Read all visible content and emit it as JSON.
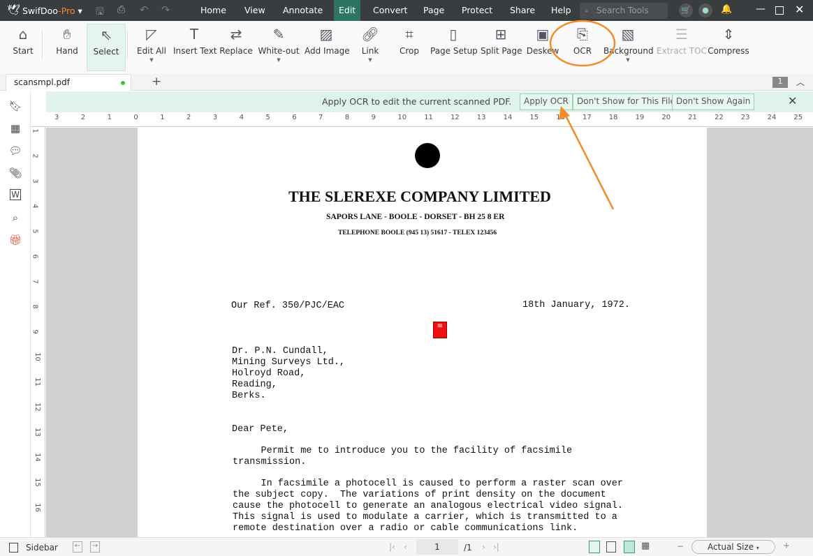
{
  "app": {
    "name": "SwifDoo",
    "name_suffix": "-Pro",
    "accent": "#2e7463",
    "brand_orange": "#f28c28"
  },
  "menu": [
    "Home",
    "View",
    "Annotate",
    "Edit",
    "Convert",
    "Page",
    "Protect",
    "Share",
    "Help"
  ],
  "active_menu": "Edit",
  "search": {
    "placeholder": "Search Tools"
  },
  "tools": [
    {
      "label": "Start",
      "icon": "home-icon"
    },
    {
      "label": "Hand",
      "icon": "hand-icon"
    },
    {
      "label": "Select",
      "icon": "cursor-icon",
      "selected": true
    },
    {
      "label": "Edit All",
      "icon": "edit-icon",
      "dropdown": true
    },
    {
      "label": "Insert Text",
      "icon": "text-icon"
    },
    {
      "label": "Replace",
      "icon": "replace-icon"
    },
    {
      "label": "White-out",
      "icon": "eraser-icon",
      "dropdown": true
    },
    {
      "label": "Add Image",
      "icon": "image-icon"
    },
    {
      "label": "Link",
      "icon": "link-icon",
      "dropdown": true
    },
    {
      "label": "Crop",
      "icon": "crop-icon"
    },
    {
      "label": "Page Setup",
      "icon": "page-setup-icon"
    },
    {
      "label": "Split Page",
      "icon": "split-icon"
    },
    {
      "label": "Deskew",
      "icon": "deskew-icon"
    },
    {
      "label": "OCR",
      "icon": "ocr-icon"
    },
    {
      "label": "Background",
      "icon": "background-icon",
      "dropdown": true
    },
    {
      "label": "Extract TOC",
      "icon": "toc-icon",
      "disabled": true
    },
    {
      "label": "Compress",
      "icon": "compress-icon"
    }
  ],
  "tab": {
    "name": "scansmpl.pdf",
    "page_badge": "1"
  },
  "ocr_bar": {
    "message": "Apply OCR to edit the current scanned PDF.",
    "apply": "Apply OCR",
    "dont_file": "Don't Show for This File",
    "dont_again": "Don't Show Again"
  },
  "ruler_h": [
    "3",
    "2",
    "1",
    "0",
    "1",
    "2",
    "3",
    "4",
    "5",
    "6",
    "7",
    "8",
    "9",
    "10",
    "11",
    "12",
    "13",
    "14",
    "15",
    "16",
    "17",
    "18",
    "19",
    "20",
    "21",
    "22",
    "23",
    "24",
    "25"
  ],
  "ruler_v": [
    "1",
    "2",
    "3",
    "4",
    "5",
    "6",
    "7",
    "8",
    "9",
    "10",
    "11",
    "12",
    "13",
    "14",
    "15",
    "16"
  ],
  "doc": {
    "company": "THE SLEREXE COMPANY LIMITED",
    "address": "SAPORS LANE - BOOLE - DORSET - BH 25 8 ER",
    "telephone": "TELEPHONE BOOLE (945 13) 51617 - TELEX 123456",
    "ref": "Our Ref. 350/PJC/EAC",
    "date": "18th January, 1972.",
    "recipient": [
      "Dr. P.N. Cundall,",
      "Mining Surveys Ltd.,",
      "Holroyd Road,",
      "Reading,",
      "Berks."
    ],
    "salutation": "Dear Pete,",
    "para1": [
      "     Permit me to introduce you to the facility of facsimile",
      "transmission."
    ],
    "para2": [
      "     In facsimile a photocell is caused to perform a raster scan over",
      "the subject copy.  The variations of print density on the document",
      "cause the photocell to generate an analogous electrical video signal.",
      "This signal is used to modulate a carrier, which is transmitted to a",
      "remote destination over a radio or cable communications link."
    ]
  },
  "status": {
    "sidebar": "Sidebar",
    "page": "1",
    "total": "/1",
    "zoom": "Actual Size"
  }
}
